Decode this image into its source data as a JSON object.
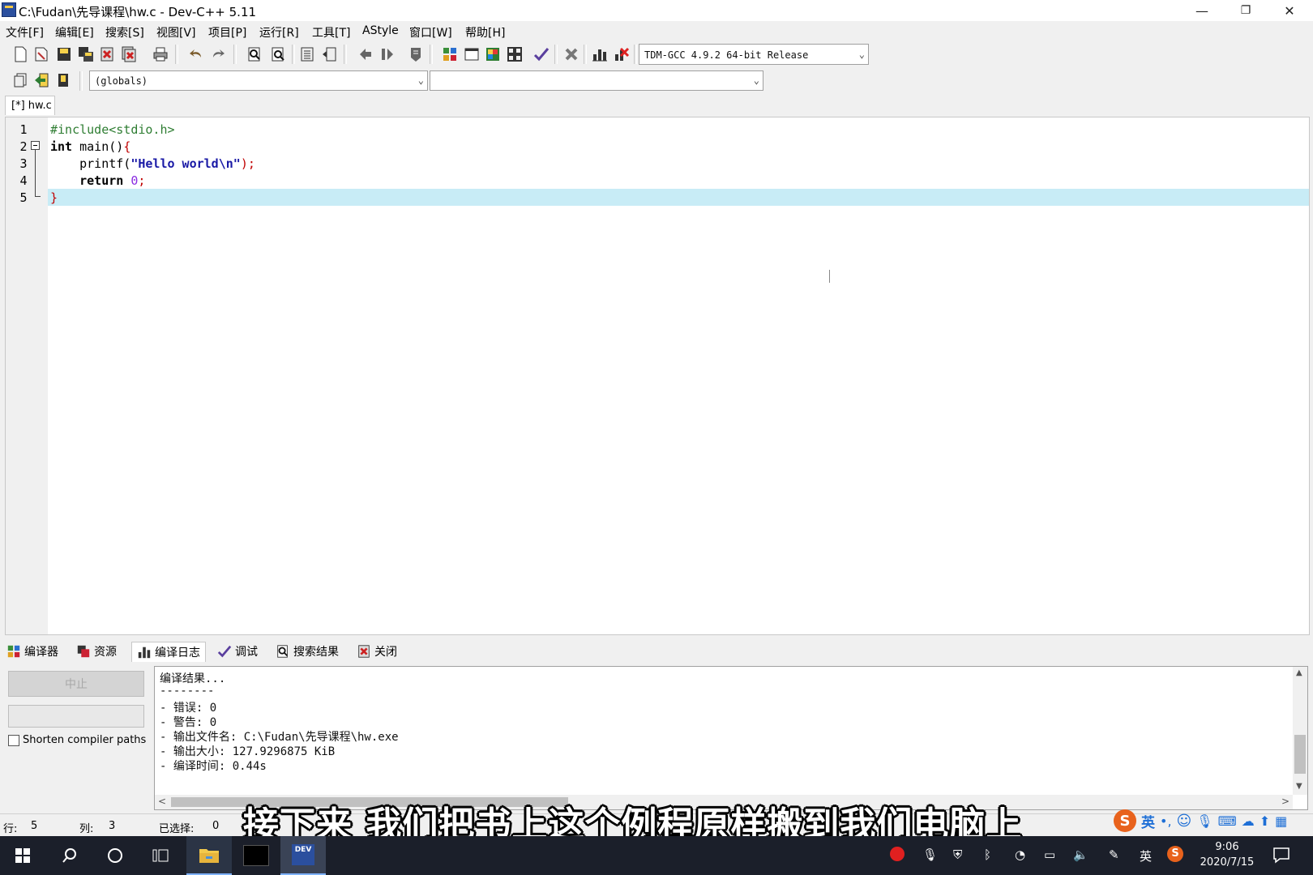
{
  "window": {
    "title": "C:\\Fudan\\先导课程\\hw.c - Dev-C++ 5.11",
    "minimize": "—",
    "restore": "❐",
    "close": "✕"
  },
  "menu": [
    "文件[F]",
    "编辑[E]",
    "搜索[S]",
    "视图[V]",
    "项目[P]",
    "运行[R]",
    "工具[T]",
    "AStyle",
    "窗口[W]",
    "帮助[H]"
  ],
  "toolbar": {
    "compiler_select": "TDM-GCC 4.9.2 64-bit Release",
    "scope_select": "(globals)",
    "symbol_select": ""
  },
  "editor": {
    "tab_label": "[*] hw.c",
    "line_numbers": [
      "1",
      "2",
      "3",
      "4",
      "5"
    ],
    "active_line": "5"
  },
  "bottom_tabs": [
    "编译器",
    "资源",
    "编译日志",
    "调试",
    "搜索结果",
    "关闭"
  ],
  "compile_log": {
    "abort_button": "中止",
    "shorten_paths_label": "Shorten compiler paths",
    "lines": [
      "编译结果...",
      "--------",
      "- 错误: 0",
      "- 警告: 0",
      "- 输出文件名: C:\\Fudan\\先导课程\\hw.exe",
      "- 输出大小: 127.9296875 KiB",
      "- 编译时间: 0.44s"
    ]
  },
  "status": {
    "row_label": "行:",
    "row_value": "5",
    "col_label": "列:",
    "col_value": "3",
    "sel_label": "已选择:",
    "sel_value": "0"
  },
  "subtitle": "接下来 我们把书上这个例程原样搬到我们电脑上",
  "taskbar": {
    "time": "9:06",
    "date": "2020/7/15",
    "ime_label": "英",
    "dev_label": "DEV"
  },
  "ime_bar": {
    "lang": "英"
  }
}
